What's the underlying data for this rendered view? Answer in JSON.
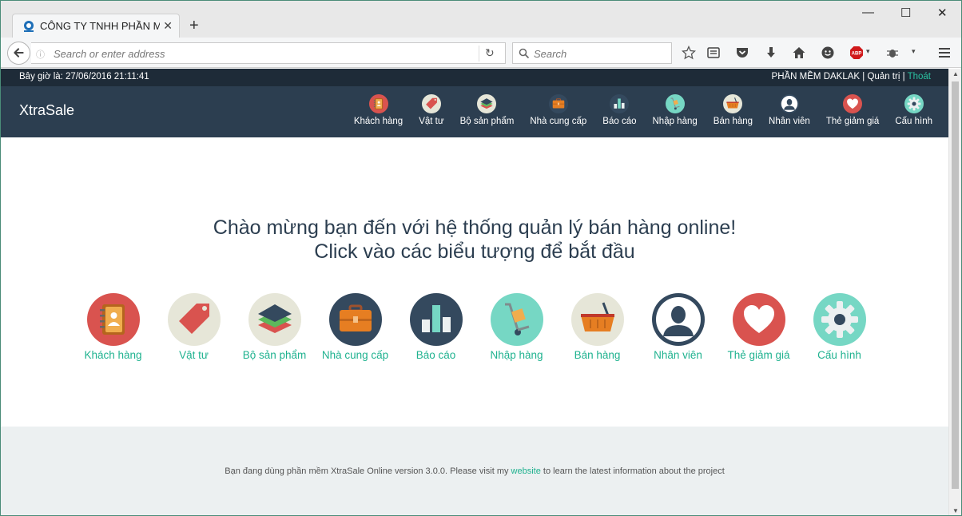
{
  "browser": {
    "tab_title": "CÔNG TY TNHH PHẦN M...",
    "address_placeholder": "Search or enter address",
    "search_placeholder": "Search"
  },
  "topbar": {
    "time": "Bây giờ là: 27/06/2016 21:11:41",
    "company": "PHẦN MỀM DAKLAK",
    "separator": " | ",
    "admin": "Quản trị",
    "logout": "Thoát"
  },
  "brand": "XtraSale",
  "menu": [
    {
      "label": "Khách hàng",
      "icon": "contacts-book-icon"
    },
    {
      "label": "Vật tư",
      "icon": "price-tag-icon"
    },
    {
      "label": "Bộ sản phẩm",
      "icon": "layers-icon"
    },
    {
      "label": "Nhà cung cấp",
      "icon": "briefcase-icon"
    },
    {
      "label": "Báo cáo",
      "icon": "bar-chart-icon"
    },
    {
      "label": "Nhập hàng",
      "icon": "hand-truck-icon"
    },
    {
      "label": "Bán hàng",
      "icon": "basket-icon"
    },
    {
      "label": "Nhân viên",
      "icon": "user-icon"
    },
    {
      "label": "Thẻ giảm giá",
      "icon": "heart-icon"
    },
    {
      "label": "Cấu hình",
      "icon": "gear-icon"
    }
  ],
  "welcome": {
    "line1": "Chào mừng bạn đến với hệ thống quản lý bán hàng online!",
    "line2": "Click vào các biểu tượng để bắt đầu"
  },
  "footer": {
    "before": "Bạn đang dùng phần mềm XtraSale Online version 3.0.0. Please visit my ",
    "link": "website",
    "after": " to learn the latest information about the project"
  },
  "colors": {
    "topbar": "#1e2b38",
    "header": "#2c3e50",
    "accent": "#1fb28f",
    "footer_bg": "#ecf0f1"
  }
}
